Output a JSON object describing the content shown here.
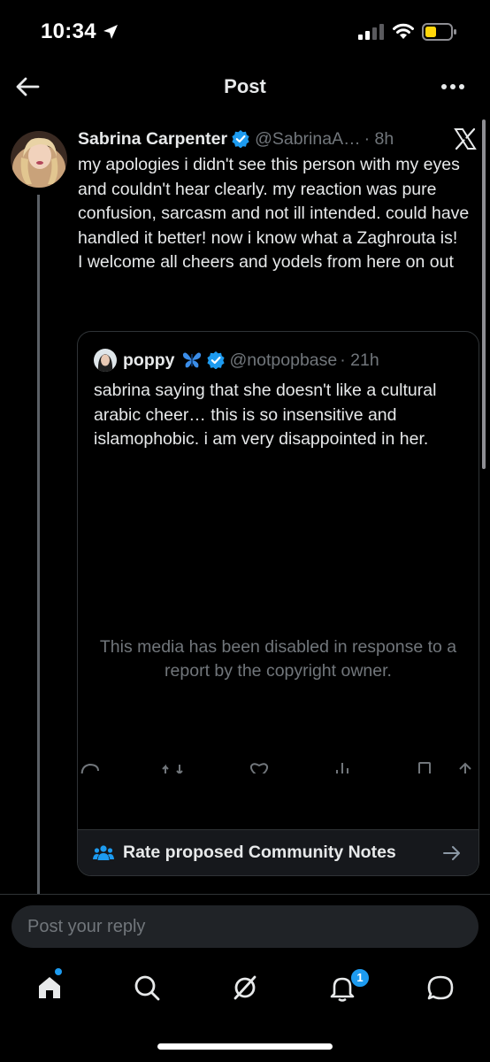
{
  "status_bar": {
    "time": "10:34"
  },
  "header": {
    "title": "Post"
  },
  "post": {
    "author_name": "Sabrina Carpenter",
    "handle": "@SabrinaA…",
    "time": "· 8h",
    "text": "my apologies i didn't see this person with my eyes and couldn't hear clearly. my reaction was pure confusion, sarcasm and not ill intended. could have handled it better! now i know what a Zaghrouta is!\nI welcome all cheers and yodels from here on out"
  },
  "quote": {
    "author_name": "poppy",
    "handle": "@notpopbase",
    "time": "· 21h",
    "text": "sabrina saying that she doesn't like a cultural arabic cheer… this is so insensitive and islamophobic. i am very disappointed in her.",
    "media_notice": "This media has been disabled in response to a report by the copyright owner.",
    "community_notes_label": "Rate proposed Community Notes"
  },
  "reply": {
    "placeholder": "Post your reply"
  },
  "tabs": {
    "notifications_badge": "1"
  },
  "colors": {
    "accent": "#1d9bf0",
    "background": "#000000",
    "muted": "#71767b",
    "text": "#e7e9ea"
  }
}
